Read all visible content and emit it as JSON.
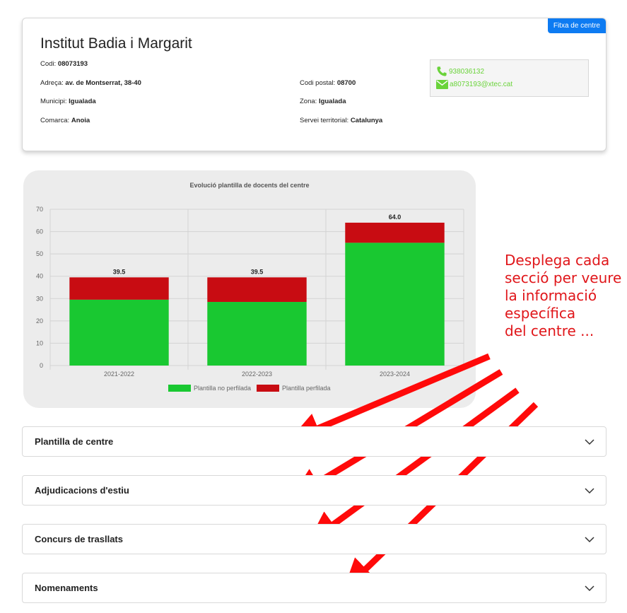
{
  "card": {
    "badge": "Fitxa de centre",
    "title": "Institut Badia i Margarit",
    "fields": {
      "codi": {
        "label": "Codi: ",
        "value": "08073193"
      },
      "adreca": {
        "label": "Adreça: ",
        "value": "av. de Montserrat, 38-40"
      },
      "municipi": {
        "label": "Municipi: ",
        "value": "Igualada"
      },
      "comarca": {
        "label": "Comarca: ",
        "value": "Anoia"
      },
      "codi_postal": {
        "label": "Codi postal: ",
        "value": "08700"
      },
      "zona": {
        "label": "Zona: ",
        "value": "Igualada"
      },
      "servei": {
        "label": "Servei territorial: ",
        "value": "Catalunya"
      }
    },
    "contact": {
      "phone": "938036132",
      "email": "a8073193@xtec.cat",
      "icons": {
        "phone": "phone-icon",
        "email": "envelope-icon"
      },
      "color": "#6ad33a"
    }
  },
  "chart_data": {
    "type": "bar",
    "stacked": true,
    "title": "Evolució plantilla de docents del centre",
    "categories": [
      "2021-2022",
      "2022-2023",
      "2023-2024"
    ],
    "series": [
      {
        "name": "Plantilla no perfilada",
        "color": "#19c831",
        "values": [
          29.5,
          28.5,
          55
        ]
      },
      {
        "name": "Plantilla perfilada",
        "color": "#c80c12",
        "values": [
          10,
          11,
          9
        ]
      }
    ],
    "totals": [
      "39.5",
      "39.5",
      "64.0"
    ],
    "ylim": [
      0,
      70
    ],
    "yticks": [
      0,
      10,
      20,
      30,
      40,
      50,
      60,
      70
    ],
    "grid": true,
    "legend": "bottom"
  },
  "annotation": {
    "lines": [
      "Desplega cada",
      "secció per veure",
      "la informació",
      "específica",
      "del centre ..."
    ],
    "color": "#e0161a"
  },
  "sections": [
    {
      "label": "Plantilla de centre"
    },
    {
      "label": "Adjudicacions d'estiu"
    },
    {
      "label": "Concurs de trasllats"
    },
    {
      "label": "Nomenaments"
    }
  ],
  "colors": {
    "badge": "#0d7bf2",
    "chart_background": "#ececec"
  }
}
